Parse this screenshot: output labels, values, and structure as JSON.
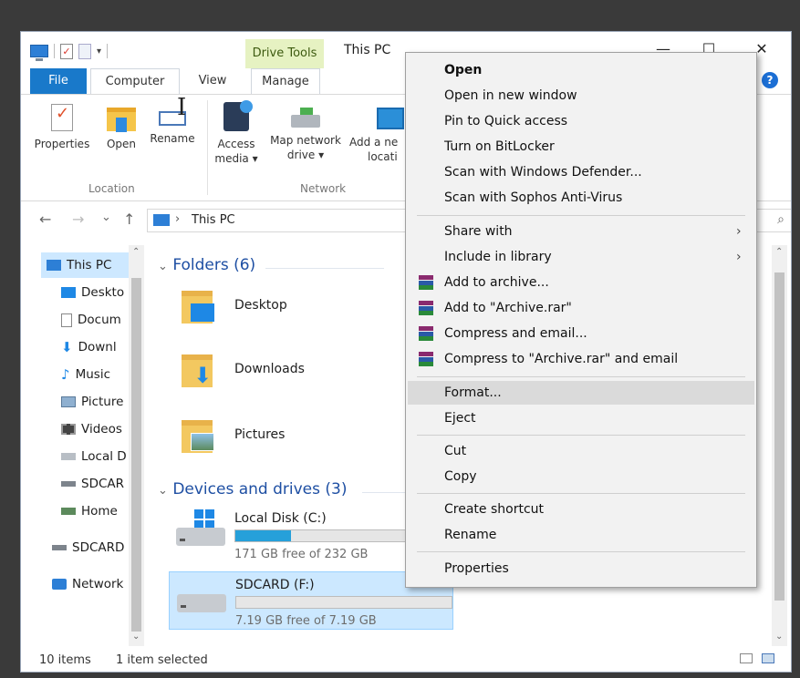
{
  "window": {
    "title": "This PC",
    "contextual_tab_header": "Drive Tools",
    "minimize": "—",
    "maximize": "☐",
    "close": "✕",
    "help": "?"
  },
  "tabs": {
    "file": "File",
    "computer": "Computer",
    "view": "View",
    "manage": "Manage"
  },
  "ribbon": {
    "location_group": "Location",
    "network_group": "Network",
    "properties": "Properties",
    "open": "Open",
    "rename": "Rename",
    "access_media_1": "Access",
    "access_media_2": "media ▾",
    "map_network_1": "Map network",
    "map_network_2": "drive ▾",
    "add_location_1": "Add a ne",
    "add_location_2": "locati"
  },
  "address": {
    "back": "←",
    "forward": "→",
    "recent": "⌄",
    "up": "↑",
    "chevron": "›",
    "path": "This PC",
    "search_icon": "⌕"
  },
  "navpane": {
    "items": [
      "This PC",
      "Deskto",
      "Docum",
      "Downl",
      "Music",
      "Picture",
      "Videos",
      "Local D",
      "SDCAR",
      "Home",
      "SDCARD",
      "Network"
    ]
  },
  "content": {
    "folders_header": "Folders (6)",
    "devices_header": "Devices and drives (3)",
    "folders": [
      "Desktop",
      "Downloads",
      "Pictures"
    ],
    "drives": [
      {
        "name": "Local Disk (C:)",
        "free": "171 GB free of 232 GB",
        "used_fraction": 0.26
      },
      {
        "name": "SDCARD (F:)",
        "free": "7.19 GB free of 7.19 GB",
        "used_fraction": 0.0
      }
    ]
  },
  "statusbar": {
    "items": "10 items",
    "selected": "1 item selected"
  },
  "context_menu": {
    "items": [
      "Open",
      "Open in new window",
      "Pin to Quick access",
      "Turn on BitLocker",
      "Scan with Windows Defender...",
      "Scan with Sophos Anti-Virus",
      "Share with",
      "Include in library",
      "Add to archive...",
      "Add to \"Archive.rar\"",
      "Compress and email...",
      "Compress to \"Archive.rar\" and email",
      "Format...",
      "Eject",
      "Cut",
      "Copy",
      "Create shortcut",
      "Rename",
      "Properties"
    ],
    "submenu_arrow": "›"
  },
  "colors": {
    "accent": "#1979ca",
    "selection": "#cce8ff",
    "drive_fill": "#26a0da",
    "section_header": "#1e4fa3"
  }
}
